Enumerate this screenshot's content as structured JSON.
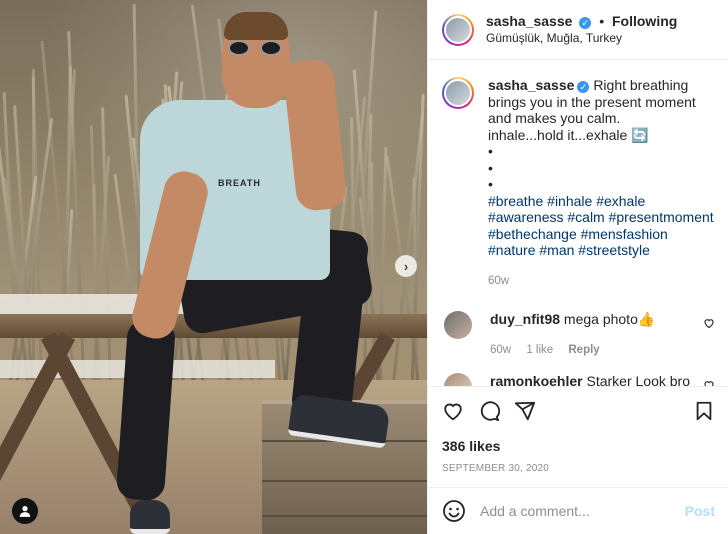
{
  "post": {
    "author": "sasha_sasse",
    "follow_dot": "•",
    "follow_label": "Following",
    "location": "Gümüşlük, Muğla, Turkey",
    "shirt_text": "BREATH"
  },
  "caption": {
    "username": "sasha_sasse",
    "text_line1": "Right breathing brings you in the present moment and makes you calm.",
    "text_line2": "inhale...hold it...exhale 🔄",
    "bullets": [
      "•",
      "•",
      "•"
    ],
    "hashtags": "#breathe #inhale #exhale #awareness #calm #presentmoment #bethechange #mensfashion #nature #man #streetstyle",
    "age": "60w"
  },
  "comments": [
    {
      "username": "duy_nfit98",
      "text": "mega photo👍",
      "age": "60w",
      "likes": "1 like",
      "reply": "Reply"
    },
    {
      "username": "ramonkoehler",
      "text": "Starker Look bro",
      "age": "",
      "likes": "",
      "reply": ""
    }
  ],
  "stats": {
    "likes": "386 likes",
    "date": "SEPTEMBER 30, 2020"
  },
  "composer": {
    "placeholder": "Add a comment...",
    "post_label": "Post"
  },
  "ui": {
    "carousel_next": "›",
    "verified_mark": "✓"
  },
  "colors": {
    "link": "#00376b",
    "verified": "#3897f0",
    "post_disabled": "#b2dffc",
    "muted": "#8e8e8e"
  }
}
